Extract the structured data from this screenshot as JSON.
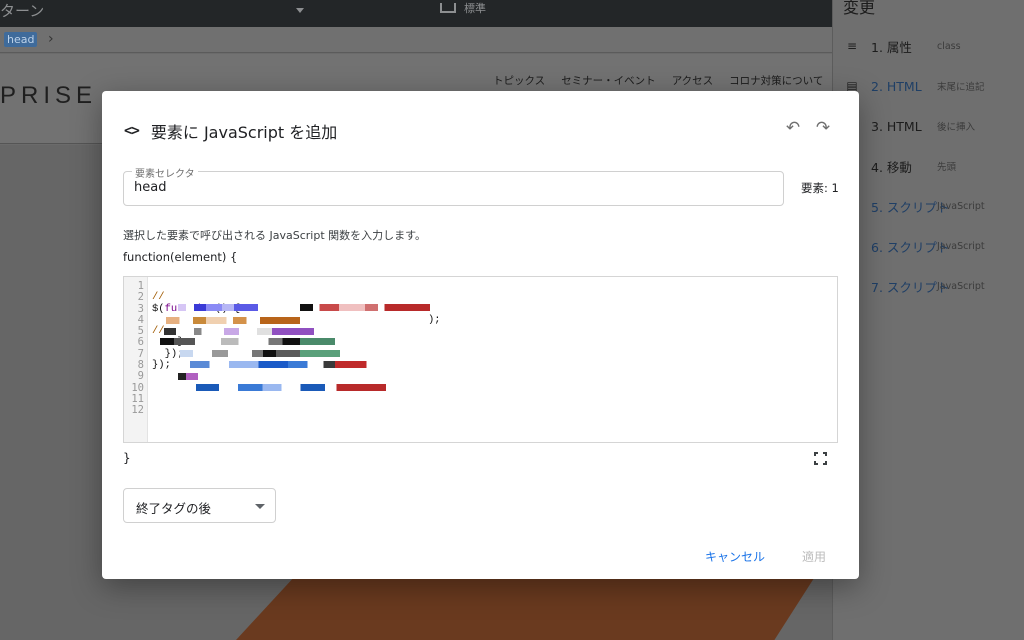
{
  "background": {
    "topbar": {
      "title": "ターン",
      "device_label": "標準"
    },
    "breadcrumb": {
      "chip": "head",
      "chevron": "›"
    },
    "site": {
      "logo": "PRISE",
      "nav": [
        "トピックス",
        "セミナー・イベント",
        "アクセス",
        "コロナ対策について"
      ]
    }
  },
  "changes_panel": {
    "title": "変更",
    "items": [
      {
        "icon": "≡",
        "label": "1. 属性",
        "sub": "class",
        "accent": false
      },
      {
        "icon": "▤",
        "label": "2. HTML",
        "sub": "末尾に追記",
        "accent": true
      },
      {
        "icon": "▤",
        "label": "3. HTML",
        "sub": "後に挿入",
        "accent": false
      },
      {
        "icon": "✥",
        "label": "4. 移動",
        "sub": "先頭",
        "accent": false
      },
      {
        "icon": "",
        "label": "5. スクリプト",
        "sub": "JavaScript",
        "accent": true
      },
      {
        "icon": "",
        "label": "6. スクリプト",
        "sub": "JavaScript",
        "accent": true
      },
      {
        "icon": "",
        "label": "7. スクリプト",
        "sub": "JavaScript",
        "accent": true
      }
    ]
  },
  "dialog": {
    "title_icon": "<>",
    "title": "要素に JavaScript を追加",
    "undo_icon": "↶",
    "redo_icon": "↷",
    "selector": {
      "legend": "要素セレクタ",
      "value": "head"
    },
    "element_count": "要素: 1",
    "description": "選択した要素で呼び出される JavaScript 関数を入力します。",
    "function_open": "function(element) {",
    "function_close": "}",
    "code": {
      "line_numbers": [
        "1",
        "2",
        "3",
        "4",
        "5",
        "6",
        "7",
        "8",
        "9",
        "10",
        "11",
        "12"
      ],
      "visible_lines": [
        "//",
        "$(function() {",
        ");",
        "//",
        "",
        "",
        "",
        "",
        "",
        "    }",
        "  });",
        "});"
      ]
    },
    "position_select": {
      "value": "終了タグの後"
    },
    "cancel_label": "キャンセル",
    "apply_label": "適用"
  }
}
